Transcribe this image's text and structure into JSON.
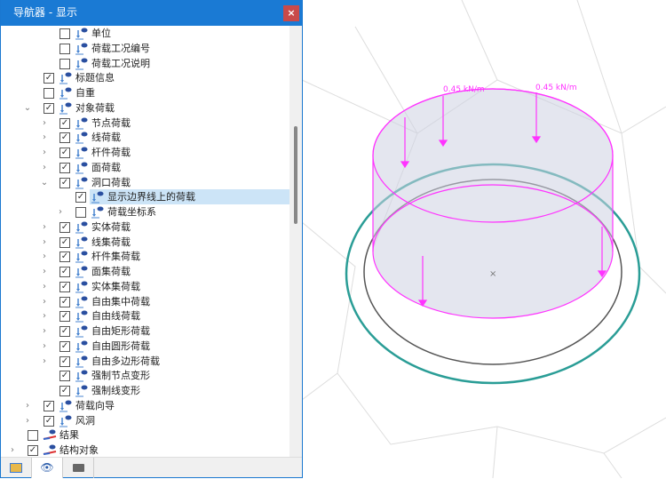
{
  "window": {
    "title": "导航器 - 显示",
    "close": "×"
  },
  "tree": [
    {
      "label": "单位",
      "level": 2,
      "checked": false,
      "chevron": null
    },
    {
      "label": "荷载工况编号",
      "level": 2,
      "checked": false,
      "chevron": null
    },
    {
      "label": "荷载工况说明",
      "level": 2,
      "checked": false,
      "chevron": null
    },
    {
      "label": "标题信息",
      "level": 1,
      "checked": true,
      "chevron": null
    },
    {
      "label": "自重",
      "level": 1,
      "checked": false,
      "chevron": null
    },
    {
      "label": "对象荷载",
      "level": 1,
      "checked": true,
      "chevron": "expanded"
    },
    {
      "label": "节点荷载",
      "level": 2,
      "checked": true,
      "chevron": "collapsed"
    },
    {
      "label": "线荷载",
      "level": 2,
      "checked": true,
      "chevron": "collapsed"
    },
    {
      "label": "杆件荷载",
      "level": 2,
      "checked": true,
      "chevron": "collapsed"
    },
    {
      "label": "面荷载",
      "level": 2,
      "checked": true,
      "chevron": "collapsed"
    },
    {
      "label": "洞口荷载",
      "level": 2,
      "checked": true,
      "chevron": "expanded"
    },
    {
      "label": "显示边界线上的荷载",
      "level": 3,
      "checked": true,
      "chevron": null,
      "selected": true
    },
    {
      "label": "荷载坐标系",
      "level": 3,
      "checked": false,
      "chevron": "collapsed"
    },
    {
      "label": "实体荷载",
      "level": 2,
      "checked": true,
      "chevron": "collapsed"
    },
    {
      "label": "线集荷载",
      "level": 2,
      "checked": true,
      "chevron": "collapsed"
    },
    {
      "label": "杆件集荷载",
      "level": 2,
      "checked": true,
      "chevron": "collapsed"
    },
    {
      "label": "面集荷载",
      "level": 2,
      "checked": true,
      "chevron": "collapsed"
    },
    {
      "label": "实体集荷载",
      "level": 2,
      "checked": true,
      "chevron": "collapsed"
    },
    {
      "label": "自由集中荷载",
      "level": 2,
      "checked": true,
      "chevron": "collapsed"
    },
    {
      "label": "自由线荷载",
      "level": 2,
      "checked": true,
      "chevron": "collapsed"
    },
    {
      "label": "自由矩形荷载",
      "level": 2,
      "checked": true,
      "chevron": "collapsed"
    },
    {
      "label": "自由圆形荷载",
      "level": 2,
      "checked": true,
      "chevron": "collapsed"
    },
    {
      "label": "自由多边形荷载",
      "level": 2,
      "checked": true,
      "chevron": "collapsed"
    },
    {
      "label": "强制节点变形",
      "level": 2,
      "checked": true,
      "chevron": null
    },
    {
      "label": "强制线变形",
      "level": 2,
      "checked": true,
      "chevron": null
    },
    {
      "label": "荷载向导",
      "level": 1,
      "checked": true,
      "chevron": "collapsed"
    },
    {
      "label": "风洞",
      "level": 1,
      "checked": true,
      "chevron": "collapsed"
    },
    {
      "label": "结果",
      "level": 0,
      "checked": false,
      "chevron": null,
      "icon": "results"
    },
    {
      "label": "结构对象",
      "level": 0,
      "checked": true,
      "chevron": "collapsed",
      "icon": "results"
    }
  ],
  "tabs": [
    {
      "icon": "data-icon"
    },
    {
      "icon": "eye-icon",
      "active": true
    },
    {
      "icon": "camera-icon"
    }
  ],
  "viewport": {
    "load_labels": [
      "0.45 kN/m",
      "0.45 kN/m"
    ],
    "load_color": "#ff33ff",
    "opening_color": "#2a9d96"
  }
}
